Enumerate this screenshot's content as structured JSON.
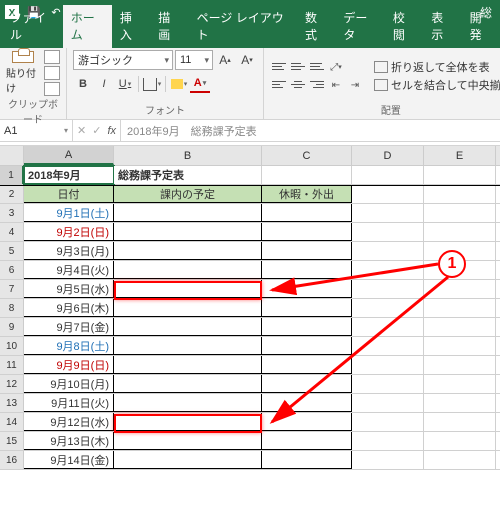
{
  "titlebar": {
    "title_partial": "総"
  },
  "tabs": [
    "ファイル",
    "ホーム",
    "挿入",
    "描画",
    "ページ レイアウト",
    "数式",
    "データ",
    "校閲",
    "表示",
    "開発"
  ],
  "ribbon": {
    "clipboard": {
      "paste": "貼り付け",
      "group": "クリップボード"
    },
    "font": {
      "name": "游ゴシック",
      "size": "11",
      "bold": "B",
      "italic": "I",
      "under": "U",
      "increase": "A",
      "decrease": "A",
      "fontcolor_letter": "A",
      "group": "フォント"
    },
    "align": {
      "wrap": "折り返して全体を表",
      "merge": "セルを結合して中央揃え",
      "group": "配置"
    }
  },
  "namebox": "A1",
  "formula": "2018年9月　総務課予定表",
  "columns": [
    "A",
    "B",
    "C",
    "D",
    "E"
  ],
  "sheet": {
    "title_month": "2018年9月",
    "title_text": "総務課予定表",
    "hdr_date": "日付",
    "hdr_plan": "課内の予定",
    "hdr_off": "休暇・外出",
    "rows": [
      {
        "n": 3,
        "date": "9月1日(土)",
        "cls": "sat"
      },
      {
        "n": 4,
        "date": "9月2日(日)",
        "cls": "sun"
      },
      {
        "n": 5,
        "date": "9月3日(月)",
        "cls": ""
      },
      {
        "n": 6,
        "date": "9月4日(火)",
        "cls": ""
      },
      {
        "n": 7,
        "date": "9月5日(水)",
        "cls": ""
      },
      {
        "n": 8,
        "date": "9月6日(木)",
        "cls": ""
      },
      {
        "n": 9,
        "date": "9月7日(金)",
        "cls": ""
      },
      {
        "n": 10,
        "date": "9月8日(土)",
        "cls": "sat"
      },
      {
        "n": 11,
        "date": "9月9日(日)",
        "cls": "sun"
      },
      {
        "n": 12,
        "date": "9月10日(月)",
        "cls": ""
      },
      {
        "n": 13,
        "date": "9月11日(火)",
        "cls": ""
      },
      {
        "n": 14,
        "date": "9月12日(水)",
        "cls": ""
      },
      {
        "n": 15,
        "date": "9月13日(木)",
        "cls": ""
      },
      {
        "n": 16,
        "date": "9月14日(金)",
        "cls": ""
      }
    ]
  },
  "annotation": {
    "marker": "1"
  }
}
